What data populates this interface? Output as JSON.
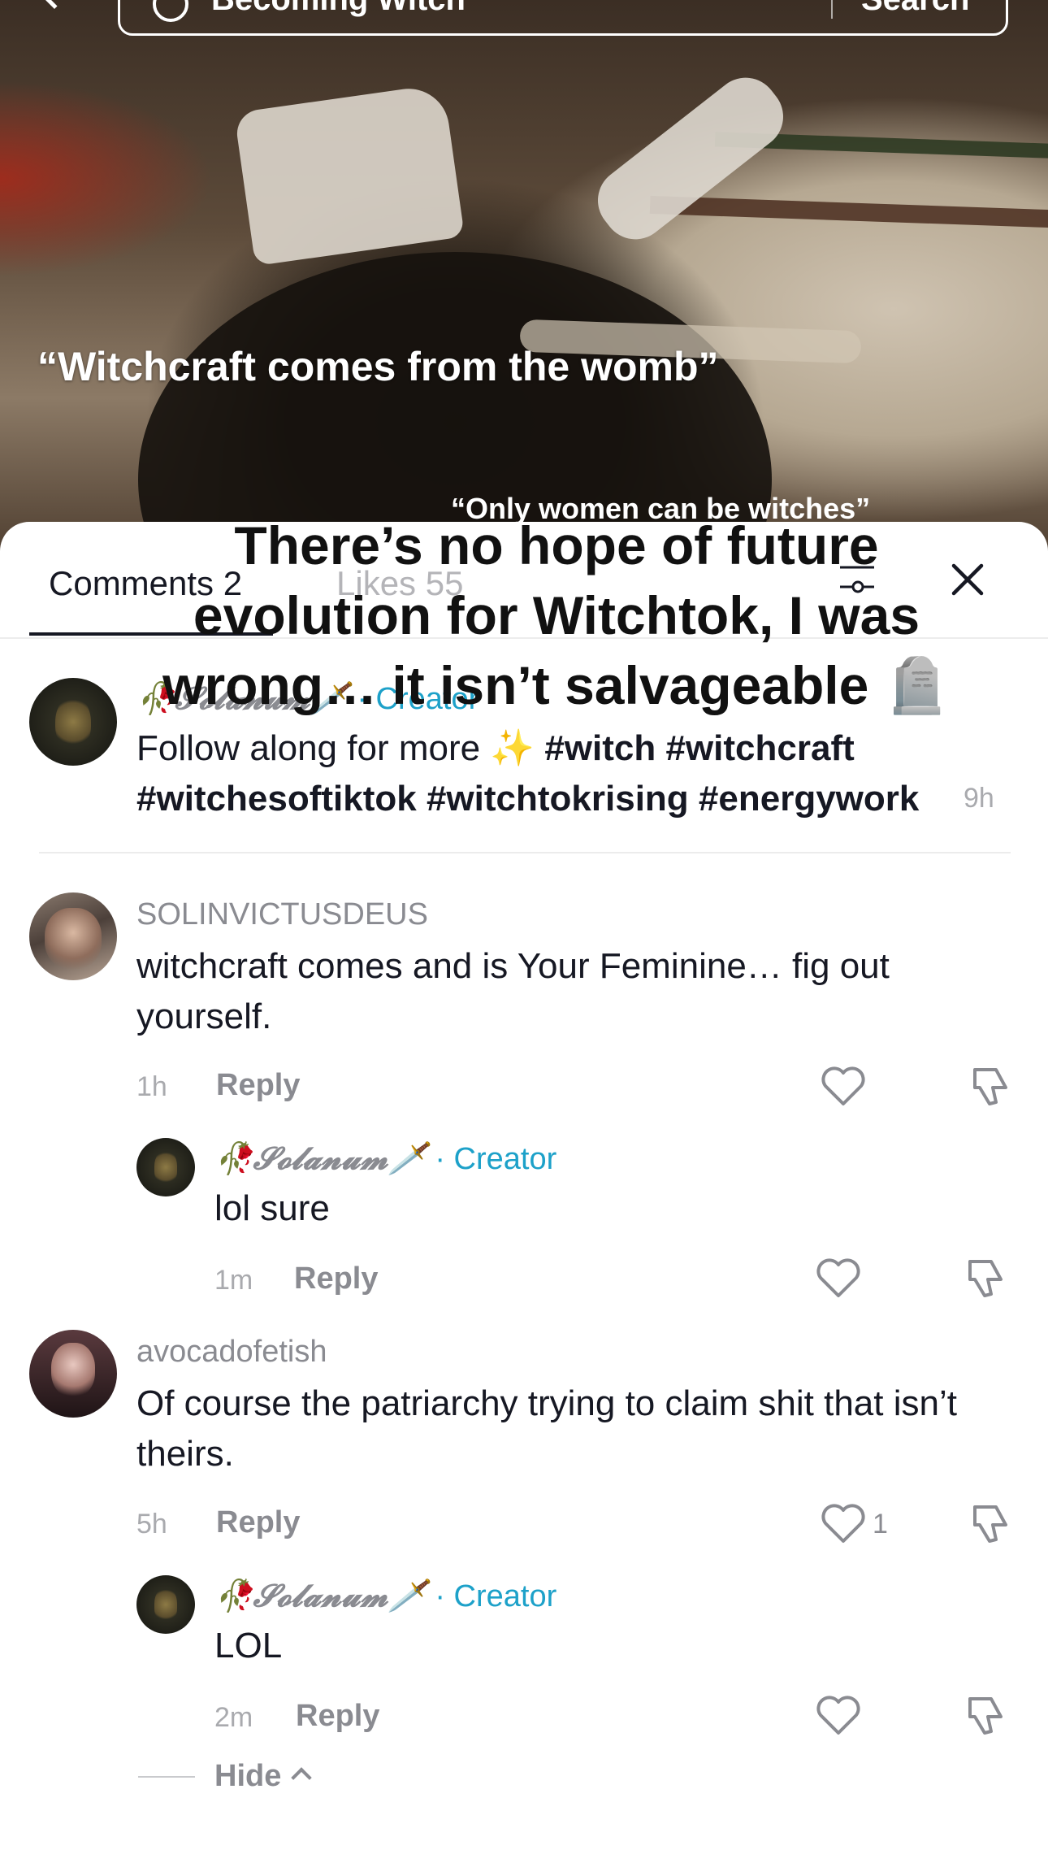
{
  "search": {
    "query": "Becoming Witch",
    "button": "Search"
  },
  "video": {
    "caption_main": "“Witchcraft comes from the womb”",
    "caption_secondary": "“Only women can be witches”"
  },
  "overlay_title": "There’s no hope of future evolution for Witchtok, I was wrong… it isn’t salvageable 🪦",
  "tabs": {
    "comments": "Comments 2",
    "likes": "Likes 55"
  },
  "post": {
    "author": "🥀𝓢𝓸𝓵𝓪𝓷𝓾𝓶🗡️",
    "creator_tag": " · Creator",
    "text": "Follow along for more ✨ ",
    "hashtags": "#witch #witchcraft #witchesoftiktok #witchtokrising #energywork",
    "time": "9h"
  },
  "comments": [
    {
      "username": "SOLINVICTUSDEUS",
      "text": "witchcraft comes and is Your Feminine… fig out yourself.",
      "time": "1h",
      "reply_label": "Reply",
      "likes": "",
      "reply": {
        "author": "🥀𝓢𝓸𝓵𝓪𝓷𝓾𝓶🗡️",
        "creator_tag": " · Creator",
        "text": "lol sure",
        "time": "1m",
        "reply_label": "Reply"
      }
    },
    {
      "username": "avocadofetish",
      "text": "Of course the patriarchy trying to claim shit that isn’t theirs.",
      "time": "5h",
      "reply_label": "Reply",
      "likes": "1",
      "reply": {
        "author": "🥀𝓢𝓸𝓵𝓪𝓷𝓾𝓶🗡️",
        "creator_tag": " · Creator",
        "text": "LOL",
        "time": "2m",
        "reply_label": "Reply"
      }
    }
  ],
  "hide_label": "Hide",
  "colors": {
    "creator_tag": "#1da1c9",
    "muted": "#8a8b91",
    "text": "#161823"
  },
  "icons": [
    "back-icon",
    "search-icon",
    "filter-icon",
    "close-icon",
    "heart-icon",
    "dislike-icon",
    "chevron-up-icon"
  ]
}
